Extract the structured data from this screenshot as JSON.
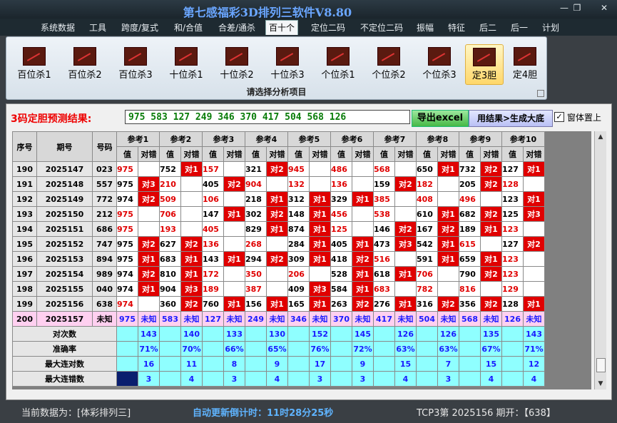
{
  "window": {
    "title": "第七感福彩3D排列三软件V8.80",
    "minimize": "—",
    "restore": "❐",
    "close": "✕"
  },
  "menu": [
    "系统数据",
    "工具",
    "跨度/复式",
    "和/合值",
    "合差/通杀",
    "百十个",
    "定位二码",
    "不定位二码",
    "振幅",
    "特征",
    "后二",
    "后一",
    "计划"
  ],
  "menu_active_index": 5,
  "ribbon": {
    "buttons": [
      "百位杀1",
      "百位杀2",
      "百位杀3",
      "十位杀1",
      "十位杀2",
      "十位杀3",
      "个位杀1",
      "个位杀2",
      "个位杀3",
      "定3胆",
      "定4胆"
    ],
    "active_index": 9,
    "caption": "请选择分析项目"
  },
  "prediction": {
    "label": "3码定胆预测结果:",
    "value": "975  583  127  249  346  370  417  504  568  126",
    "export_button": "导出excel",
    "generate_button": "用结果>生成大底",
    "checkbox_checked": true,
    "checkbox_label": "窗体置上"
  },
  "table": {
    "col_headers": [
      "序号",
      "期号",
      "号码"
    ],
    "ref_headers": [
      "参考1",
      "参考2",
      "参考3",
      "参考4",
      "参考5",
      "参考6",
      "参考7",
      "参考8",
      "参考9",
      "参考10"
    ],
    "sub_headers": [
      "值",
      "对错"
    ],
    "rows": [
      {
        "seq": "190",
        "period": "2025147",
        "num": "023",
        "cells": [
          [
            "975",
            "r",
            ""
          ],
          [
            "752",
            "k",
            "对1"
          ],
          [
            "157",
            "r",
            ""
          ],
          [
            "321",
            "k",
            "对2"
          ],
          [
            "945",
            "r",
            ""
          ],
          [
            "486",
            "r",
            ""
          ],
          [
            "568",
            "r",
            ""
          ],
          [
            "650",
            "k",
            "对1"
          ],
          [
            "732",
            "k",
            "对2"
          ],
          [
            "127",
            "k",
            "对1"
          ]
        ]
      },
      {
        "seq": "191",
        "period": "2025148",
        "num": "557",
        "cells": [
          [
            "975",
            "k",
            "对3"
          ],
          [
            "210",
            "r",
            ""
          ],
          [
            "405",
            "k",
            "对2"
          ],
          [
            "904",
            "r",
            ""
          ],
          [
            "132",
            "r",
            ""
          ],
          [
            "136",
            "r",
            ""
          ],
          [
            "159",
            "k",
            "对2"
          ],
          [
            "182",
            "r",
            ""
          ],
          [
            "205",
            "k",
            "对2"
          ],
          [
            "128",
            "r",
            ""
          ]
        ]
      },
      {
        "seq": "192",
        "period": "2025149",
        "num": "772",
        "cells": [
          [
            "974",
            "k",
            "对2"
          ],
          [
            "509",
            "r",
            ""
          ],
          [
            "106",
            "r",
            ""
          ],
          [
            "218",
            "k",
            "对1"
          ],
          [
            "312",
            "k",
            "对1"
          ],
          [
            "329",
            "k",
            "对1"
          ],
          [
            "385",
            "r",
            ""
          ],
          [
            "408",
            "r",
            ""
          ],
          [
            "496",
            "r",
            ""
          ],
          [
            "123",
            "k",
            "对1"
          ]
        ]
      },
      {
        "seq": "193",
        "period": "2025150",
        "num": "212",
        "cells": [
          [
            "975",
            "r",
            ""
          ],
          [
            "706",
            "r",
            ""
          ],
          [
            "147",
            "k",
            "对1"
          ],
          [
            "302",
            "k",
            "对2"
          ],
          [
            "148",
            "k",
            "对1"
          ],
          [
            "456",
            "r",
            ""
          ],
          [
            "538",
            "r",
            ""
          ],
          [
            "610",
            "k",
            "对1"
          ],
          [
            "682",
            "k",
            "对2"
          ],
          [
            "125",
            "k",
            "对3"
          ]
        ]
      },
      {
        "seq": "194",
        "period": "2025151",
        "num": "686",
        "cells": [
          [
            "975",
            "r",
            ""
          ],
          [
            "193",
            "r",
            ""
          ],
          [
            "405",
            "r",
            ""
          ],
          [
            "829",
            "k",
            "对1"
          ],
          [
            "874",
            "k",
            "对1"
          ],
          [
            "125",
            "r",
            ""
          ],
          [
            "146",
            "k",
            "对2"
          ],
          [
            "167",
            "k",
            "对2"
          ],
          [
            "189",
            "k",
            "对1"
          ],
          [
            "123",
            "r",
            ""
          ]
        ]
      },
      {
        "seq": "195",
        "period": "2025152",
        "num": "747",
        "cells": [
          [
            "975",
            "k",
            "对2"
          ],
          [
            "627",
            "k",
            "对2"
          ],
          [
            "136",
            "r",
            ""
          ],
          [
            "268",
            "r",
            ""
          ],
          [
            "284",
            "k",
            "对1"
          ],
          [
            "405",
            "k",
            "对1"
          ],
          [
            "473",
            "k",
            "对3"
          ],
          [
            "542",
            "k",
            "对1"
          ],
          [
            "615",
            "r",
            ""
          ],
          [
            "127",
            "k",
            "对2"
          ]
        ]
      },
      {
        "seq": "196",
        "period": "2025153",
        "num": "894",
        "cells": [
          [
            "975",
            "k",
            "对1"
          ],
          [
            "683",
            "k",
            "对1"
          ],
          [
            "143",
            "k",
            "对1"
          ],
          [
            "294",
            "k",
            "对2"
          ],
          [
            "309",
            "k",
            "对1"
          ],
          [
            "418",
            "k",
            "对2"
          ],
          [
            "516",
            "r",
            ""
          ],
          [
            "591",
            "k",
            "对1"
          ],
          [
            "659",
            "k",
            "对1"
          ],
          [
            "123",
            "r",
            ""
          ]
        ]
      },
      {
        "seq": "197",
        "period": "2025154",
        "num": "989",
        "cells": [
          [
            "974",
            "k",
            "对2"
          ],
          [
            "810",
            "k",
            "对1"
          ],
          [
            "172",
            "r",
            ""
          ],
          [
            "350",
            "r",
            ""
          ],
          [
            "206",
            "r",
            ""
          ],
          [
            "528",
            "k",
            "对1"
          ],
          [
            "618",
            "k",
            "对1"
          ],
          [
            "706",
            "r",
            ""
          ],
          [
            "790",
            "k",
            "对2"
          ],
          [
            "123",
            "r",
            ""
          ]
        ]
      },
      {
        "seq": "198",
        "period": "2025155",
        "num": "040",
        "cells": [
          [
            "974",
            "k",
            "对1"
          ],
          [
            "904",
            "k",
            "对3"
          ],
          [
            "189",
            "r",
            ""
          ],
          [
            "387",
            "r",
            ""
          ],
          [
            "409",
            "k",
            "对3"
          ],
          [
            "584",
            "k",
            "对1"
          ],
          [
            "683",
            "r",
            ""
          ],
          [
            "782",
            "r",
            ""
          ],
          [
            "816",
            "r",
            ""
          ],
          [
            "129",
            "r",
            ""
          ]
        ]
      },
      {
        "seq": "199",
        "period": "2025156",
        "num": "638",
        "cells": [
          [
            "974",
            "r",
            ""
          ],
          [
            "360",
            "k",
            "对2"
          ],
          [
            "760",
            "k",
            "对1"
          ],
          [
            "156",
            "k",
            "对1"
          ],
          [
            "165",
            "k",
            "对1"
          ],
          [
            "263",
            "k",
            "对2"
          ],
          [
            "276",
            "k",
            "对1"
          ],
          [
            "316",
            "k",
            "对2"
          ],
          [
            "356",
            "k",
            "对2"
          ],
          [
            "128",
            "k",
            "对1"
          ]
        ]
      }
    ],
    "prediction_row": {
      "seq": "200",
      "period": "2025157",
      "num": "未知",
      "values": [
        "975",
        "583",
        "127",
        "249",
        "346",
        "370",
        "417",
        "504",
        "568",
        "126"
      ],
      "status": "未知"
    },
    "stats": [
      {
        "label": "对次数",
        "values": [
          "143",
          "140",
          "133",
          "130",
          "152",
          "145",
          "126",
          "126",
          "135",
          "143"
        ]
      },
      {
        "label": "准确率",
        "values": [
          "71%",
          "70%",
          "66%",
          "65%",
          "76%",
          "72%",
          "63%",
          "63%",
          "67%",
          "71%"
        ]
      },
      {
        "label": "最大连对数",
        "values": [
          "16",
          "11",
          "8",
          "9",
          "17",
          "9",
          "15",
          "7",
          "15",
          "12"
        ]
      },
      {
        "label": "最大连错数",
        "values": [
          "3",
          "4",
          "3",
          "4",
          "3",
          "3",
          "4",
          "3",
          "4",
          "4"
        ]
      }
    ]
  },
  "scrollbar": {
    "up": "▲",
    "down": "▼"
  },
  "status": {
    "current": "当前数据为：[体彩排列三]",
    "countdown_label": "自动更新倒计时：",
    "countdown": "11时28分25秒",
    "draw_info": "TCP3第  2025156  期开：【638】"
  },
  "colors": {
    "hit": "#e00000",
    "miss_text": "#e00000",
    "prediction_bg": "#ffd0f0",
    "stats_bg": "#8fffff",
    "title": "#6aa6ff"
  }
}
